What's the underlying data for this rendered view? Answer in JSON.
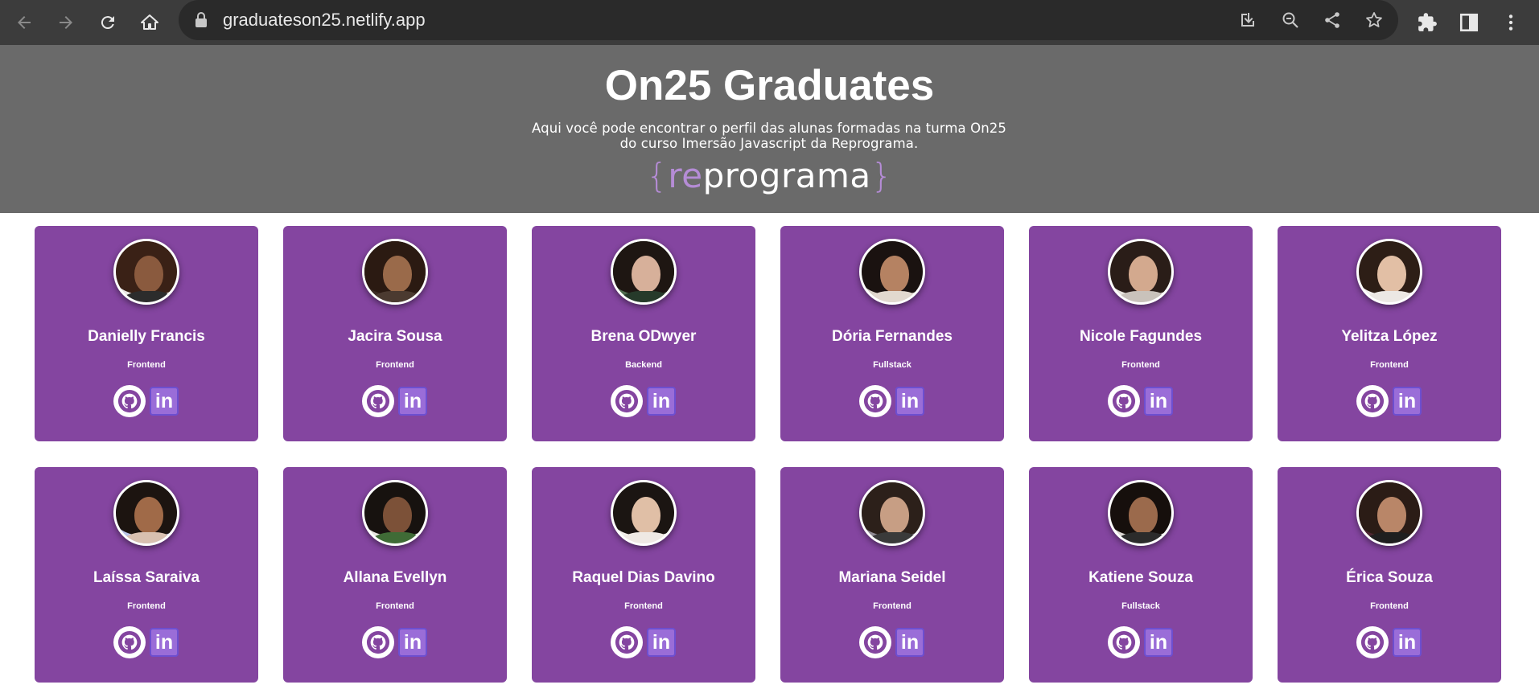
{
  "browser": {
    "url": "graduateson25.netlify.app"
  },
  "header": {
    "title": "On25 Graduates",
    "subtitle_line1": "Aqui você pode encontrar o perfil das alunas formadas na turma On25",
    "subtitle_line2": "do curso Imersão Javascript da Reprograma.",
    "logo": {
      "open_brace": "{",
      "re": "re",
      "rest": "programa",
      "close_brace": "}"
    }
  },
  "colors": {
    "card": "#8445a0",
    "header_bg": "#6a6a6a",
    "accent": "#b58cd6",
    "linkedin": "#9a6dd8"
  },
  "github_icon": "github-icon",
  "linkedin_label": "in",
  "graduates": [
    {
      "name": "Danielly Francis",
      "role": "Frontend",
      "hair": "#3a2116",
      "skin": "#8a5a3e",
      "shirt": "#2c2c2c",
      "bg": "#e9e6e2"
    },
    {
      "name": "Jacira Sousa",
      "role": "Frontend",
      "hair": "#2b1a12",
      "skin": "#9a6a4a",
      "shirt": "#4b3a30",
      "bg": "#3a2b22"
    },
    {
      "name": "Brena ODwyer",
      "role": "Backend",
      "hair": "#1e1612",
      "skin": "#d7b09a",
      "shirt": "#263a2a",
      "bg": "#4e6b4d"
    },
    {
      "name": "Dória Fernandes",
      "role": "Fullstack",
      "hair": "#1a1210",
      "skin": "#b58262",
      "shirt": "#e2d9cf",
      "bg": "#d9d2c8"
    },
    {
      "name": "Nicole Fagundes",
      "role": "Frontend",
      "hair": "#2a1d18",
      "skin": "#d3a98e",
      "shirt": "#c9c2bb",
      "bg": "#e7e3de"
    },
    {
      "name": "Yelitza López",
      "role": "Frontend",
      "hair": "#2d1e16",
      "skin": "#e2bfa5",
      "shirt": "#ece8e4",
      "bg": "#f1efed"
    },
    {
      "name": "Laíssa Saraiva",
      "role": "Frontend",
      "hair": "#1c1410",
      "skin": "#a06a48",
      "shirt": "#d8c0b0",
      "bg": "#b9c4e8"
    },
    {
      "name": "Allana Evellyn",
      "role": "Frontend",
      "hair": "#17120f",
      "skin": "#7c5138",
      "shirt": "#3f6b36",
      "bg": "#e6e4df"
    },
    {
      "name": "Raquel Dias Davino",
      "role": "Frontend",
      "hair": "#1b1512",
      "skin": "#e0bfa6",
      "shirt": "#efe9e4",
      "bg": "#f0ede9"
    },
    {
      "name": "Mariana Seidel",
      "role": "Frontend",
      "hair": "#2c201a",
      "skin": "#c79e84",
      "shirt": "#3a3a3a",
      "bg": "#8f8a93"
    },
    {
      "name": "Katiene Souza",
      "role": "Fullstack",
      "hair": "#160f0c",
      "skin": "#9b6a4c",
      "shirt": "#2b2b2b",
      "bg": "#dcd8d4"
    },
    {
      "name": "Érica Souza",
      "role": "Frontend",
      "hair": "#2b1c16",
      "skin": "#b98668",
      "shirt": "#1f1f1f",
      "bg": "#4c2630"
    }
  ]
}
